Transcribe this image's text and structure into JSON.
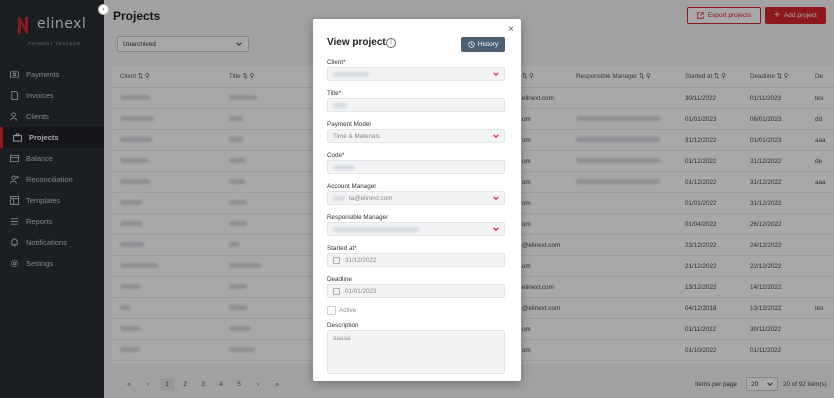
{
  "app": {
    "logo_text": "elinexl",
    "logo_subtitle": "PAYMENT TRACKER",
    "brand_color": "#d7262b"
  },
  "sidebar": {
    "items": [
      {
        "label": "Payments",
        "icon": "payments-icon"
      },
      {
        "label": "Invoices",
        "icon": "invoice-icon"
      },
      {
        "label": "Clients",
        "icon": "clients-icon"
      },
      {
        "label": "Projects",
        "icon": "projects-icon",
        "active": true
      },
      {
        "label": "Balance",
        "icon": "balance-icon"
      },
      {
        "label": "Reconciliation",
        "icon": "reconciliation-icon"
      },
      {
        "label": "Templates",
        "icon": "templates-icon"
      },
      {
        "label": "Reports",
        "icon": "reports-icon"
      },
      {
        "label": "Notifications",
        "icon": "bell-icon"
      },
      {
        "label": "Settings",
        "icon": "gear-icon"
      }
    ]
  },
  "header": {
    "title": "Projects",
    "export_label": "Export projects",
    "add_label": "Add project"
  },
  "filter": {
    "selected": "Unarchived"
  },
  "table": {
    "columns": [
      "Client",
      "Title",
      "Responsible Manager",
      "Started at",
      "Deadline",
      "De"
    ],
    "rows": [
      {
        "manager": "elinext.com",
        "started": "30/11/2022",
        "deadline": "01/11/2023",
        "extra": "tes"
      },
      {
        "manager": "om",
        "started": "01/01/2023",
        "deadline": "06/01/2023",
        "extra": "dd"
      },
      {
        "manager": "om",
        "started": "31/12/2022",
        "deadline": "01/01/2023",
        "extra": "aaa"
      },
      {
        "manager": "om",
        "started": "01/12/2022",
        "deadline": "31/12/2022",
        "extra": "de"
      },
      {
        "manager": "om",
        "started": "01/12/2022",
        "deadline": "31/12/2022",
        "extra": "aaa"
      },
      {
        "manager": "om",
        "started": "01/01/2022",
        "deadline": "31/12/2022",
        "extra": ""
      },
      {
        "manager": "om",
        "started": "01/04/2022",
        "deadline": "26/12/2022",
        "extra": ""
      },
      {
        "manager": "@elinext.com",
        "started": "23/12/2022",
        "deadline": "24/12/2022",
        "extra": ""
      },
      {
        "manager": "om",
        "started": "21/12/2022",
        "deadline": "22/12/2022",
        "extra": ""
      },
      {
        "manager": "elinext.com",
        "started": "13/12/2022",
        "deadline": "14/12/2022",
        "extra": ""
      },
      {
        "manager": "@elinext.com",
        "started": "04/12/2018",
        "deadline": "13/12/2022",
        "extra": "tes"
      },
      {
        "manager": "om",
        "started": "01/11/2022",
        "deadline": "30/11/2022",
        "extra": ""
      },
      {
        "manager": "om",
        "started": "01/10/2022",
        "deadline": "01/11/2022",
        "extra": ""
      }
    ]
  },
  "pagination": {
    "first": "«",
    "prev": "‹",
    "next": "›",
    "last": "»",
    "pages": [
      "1",
      "2",
      "3",
      "4",
      "5"
    ],
    "current": "1",
    "items_per_page_label": "Items per page",
    "items_per_page": "20",
    "range": "20 of 92 item(s)"
  },
  "modal": {
    "title": "View project",
    "close": "×",
    "history_label": "History",
    "client_label": "Client*",
    "title_label": "Title*",
    "payment_model_label": "Payment Model",
    "payment_model_value": "Time & Materials",
    "code_label": "Code*",
    "account_manager_label": "Account Manager",
    "account_manager_value": "ta@elinext.com",
    "responsible_manager_label": "Responsible Manager",
    "started_label": "Started at*",
    "started_value": "31/12/2022",
    "deadline_label": "Deadline",
    "deadline_value": "01/01/2023",
    "active_label": "Active",
    "description_label": "Description",
    "description_value": "aaaaa"
  }
}
